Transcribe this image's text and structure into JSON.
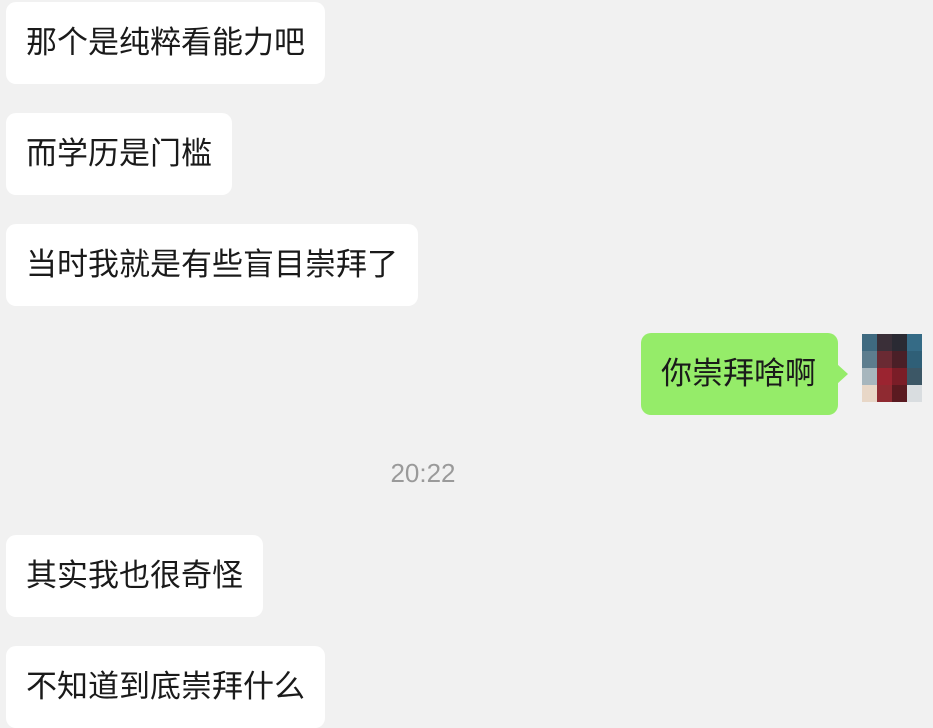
{
  "messages": [
    {
      "text": "那个是纯粹看能力吧",
      "side": "received"
    },
    {
      "text": "而学历是门槛",
      "side": "received"
    },
    {
      "text": "当时我就是有些盲目崇拜了",
      "side": "received"
    },
    {
      "text": "你崇拜啥啊",
      "side": "sent"
    },
    {
      "text": "其实我也很奇怪",
      "side": "received"
    },
    {
      "text": "不知道到底崇拜什么",
      "side": "received"
    }
  ],
  "timestamp": "20:22",
  "colors": {
    "background": "#f1f1f1",
    "received_bubble": "#ffffff",
    "sent_bubble": "#95ec69",
    "timestamp_text": "#9a9a9a"
  },
  "avatar": {
    "icon": "pixelated-avatar-icon"
  }
}
